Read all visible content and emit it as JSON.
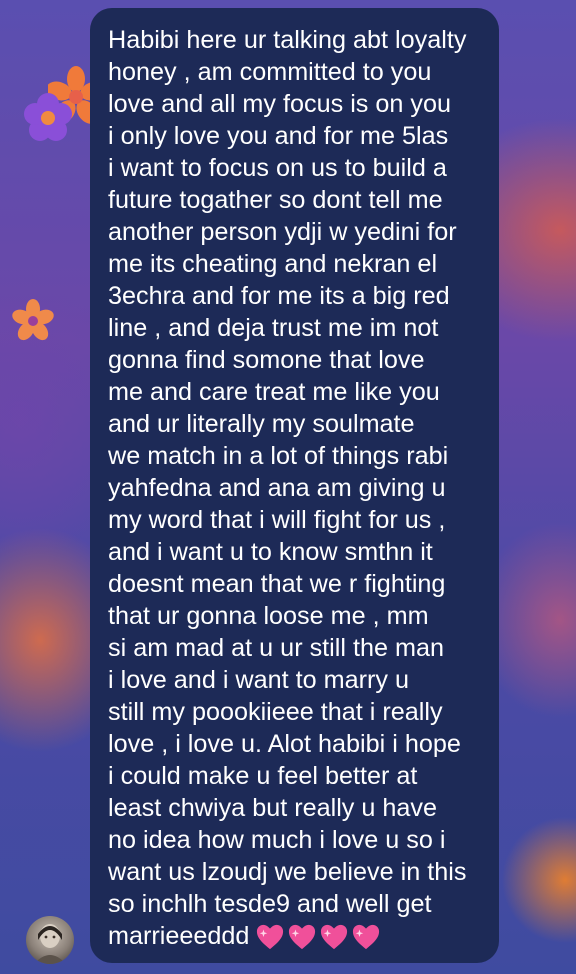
{
  "chat": {
    "message_lines": [
      "Habibi here ur talking abt loyalty",
      "honey , am committed to you",
      "love and all my focus is on you",
      "i only love you and for me 5las",
      "i want to focus on us to build a",
      "future togather so dont tell me",
      "another person ydji w yedini for",
      "me its cheating and nekran el",
      "3echra and for me its a big red",
      "line , and deja trust me im not",
      "gonna find somone that love",
      "me and care treat me like you",
      "and ur literally my soulmate",
      "we match in a lot of things rabi",
      "yahfedna and ana am giving u",
      "my word that i will fight for us ,",
      "and i want u to know smthn it",
      "doesnt mean that we r fighting",
      "that ur gonna loose me , mm",
      "si am mad at u ur still the man",
      "i love and i want to marry u",
      "still my poookiieee that i really",
      "love , i love u. Alot habibi i hope",
      "i could make u feel better at",
      "least chwiya but really u have",
      "no idea how much i love u so i",
      "want us lzoudj we believe in this",
      "so inchlh tesde9 and well get",
      "marrieeeddd"
    ],
    "emoji_hearts": [
      "💗",
      "💗",
      "💗",
      "💗"
    ],
    "bubble_color": "#1d2a57",
    "text_color": "#ffffff",
    "sender_avatar_icon": "avatar-photo"
  },
  "background": {
    "decorations": [
      "flower-icon",
      "flower-icon",
      "flower-icon"
    ]
  }
}
